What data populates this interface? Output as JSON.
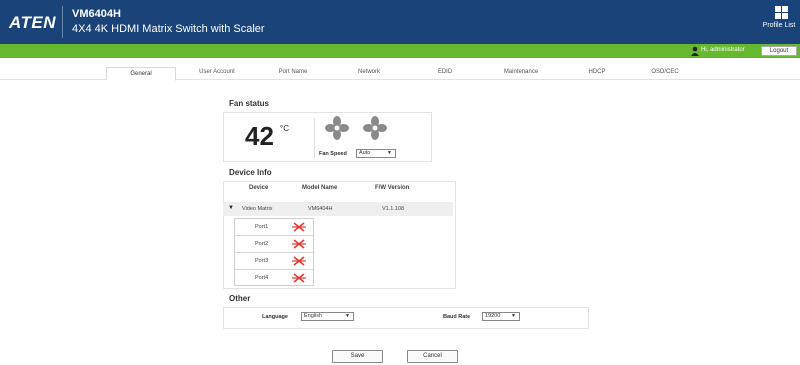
{
  "header": {
    "logo": "ATEN",
    "model": "VM6404H",
    "subtitle": "4X4 4K HDMI Matrix Switch with Scaler",
    "profile_label": "Profile List"
  },
  "userbar": {
    "greeting": "Hi, administrator",
    "logout_label": "Logout"
  },
  "tabs": [
    {
      "label": "General",
      "active": true
    },
    {
      "label": "User Account",
      "active": false
    },
    {
      "label": "Port Name",
      "active": false
    },
    {
      "label": "Network",
      "active": false
    },
    {
      "label": "EDID",
      "active": false
    },
    {
      "label": "Maintenance",
      "active": false
    },
    {
      "label": "HDCP",
      "active": false
    },
    {
      "label": "OSD/CEC",
      "active": false
    }
  ],
  "fan_status": {
    "title": "Fan status",
    "temperature": "42",
    "unit": "°C",
    "fan_speed_label": "Fan Speed",
    "fan_speed_value": "Auto"
  },
  "device_info": {
    "title": "Device Info",
    "columns": [
      "Device",
      "Model Name",
      "F/W Version"
    ],
    "row": {
      "device": "Video Matrix",
      "model": "VM6404H",
      "firmware": "V1.1.108"
    },
    "ports": [
      "Port1",
      "Port2",
      "Port3",
      "Port4"
    ]
  },
  "other": {
    "title": "Other",
    "language_label": "Language",
    "language_value": "English",
    "baud_label": "Baud Rate",
    "baud_value": "19200"
  },
  "actions": {
    "save_label": "Save",
    "cancel_label": "Cancel"
  },
  "colors": {
    "header_bg": "#1a4379",
    "green_bar": "#66b82f",
    "port_x": "#e53935"
  }
}
